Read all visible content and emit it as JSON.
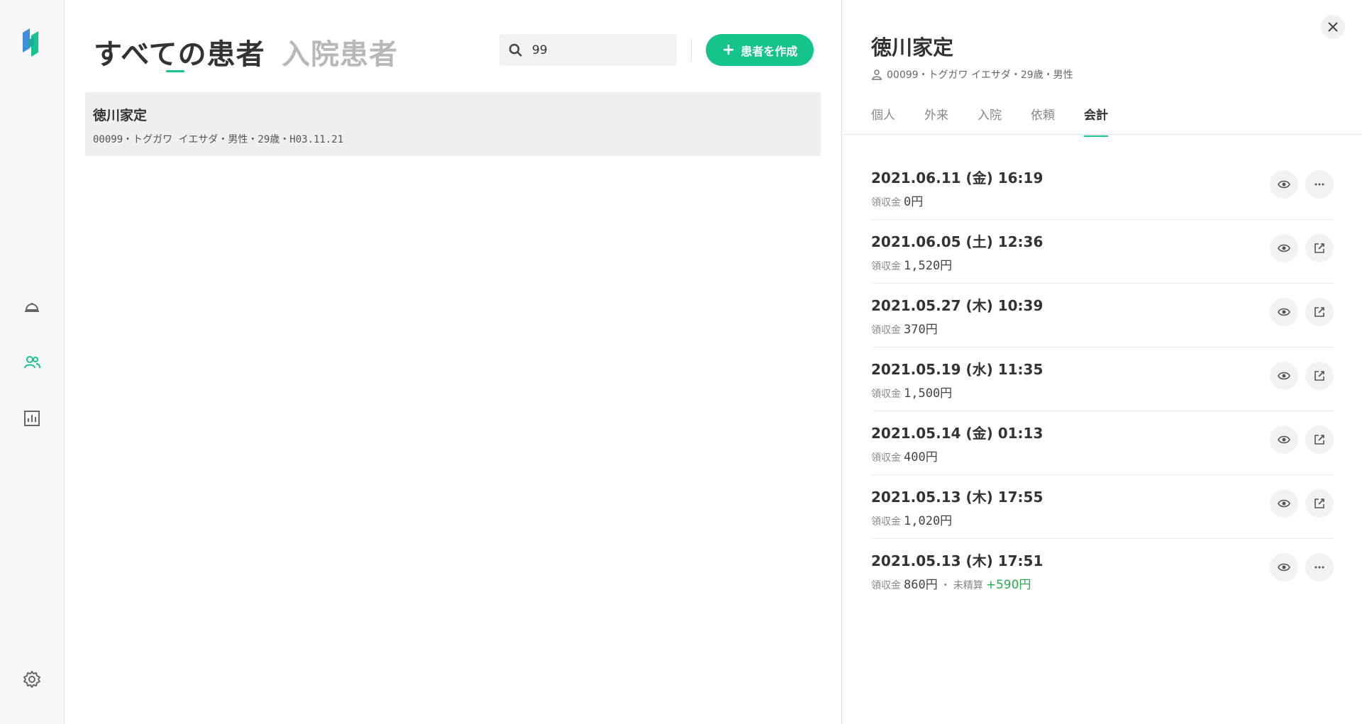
{
  "main": {
    "tab_all": "すべての患者",
    "tab_inpatient": "入院患者",
    "search_value": "99",
    "create_button": "患者を作成",
    "patients": [
      {
        "name": "徳川家定",
        "info": "00099・トグガワ イエサダ・男性・29歳・H03.11.21"
      }
    ]
  },
  "detail": {
    "name": "徳川家定",
    "meta": "00099・トグガワ イエサダ・29歳・男性",
    "tabs": [
      "個人",
      "外来",
      "入院",
      "依頼",
      "会計"
    ],
    "active_tab": "会計",
    "billings": [
      {
        "date": "2021.06.11 (金) 16:19",
        "label": "領収金",
        "amount": "0円",
        "action": "more-icon"
      },
      {
        "date": "2021.06.05 (土) 12:36",
        "label": "領収金",
        "amount": "1,520円",
        "action": "open-external-icon"
      },
      {
        "date": "2021.05.27 (木) 10:39",
        "label": "領収金",
        "amount": "370円",
        "action": "open-external-icon"
      },
      {
        "date": "2021.05.19 (水) 11:35",
        "label": "領収金",
        "amount": "1,500円",
        "action": "open-external-icon"
      },
      {
        "date": "2021.05.14 (金) 01:13",
        "label": "領収金",
        "amount": "400円",
        "action": "open-external-icon"
      },
      {
        "date": "2021.05.13 (木) 17:55",
        "label": "領収金",
        "amount": "1,020円",
        "action": "open-external-icon"
      },
      {
        "date": "2021.05.13 (木) 17:51",
        "label": "領収金",
        "amount": "860円",
        "pending_label": "未精算",
        "pending_amount": "+590円",
        "action": "more-icon"
      }
    ]
  },
  "colors": {
    "accent": "#17c38c",
    "pending": "#2ea84f"
  }
}
